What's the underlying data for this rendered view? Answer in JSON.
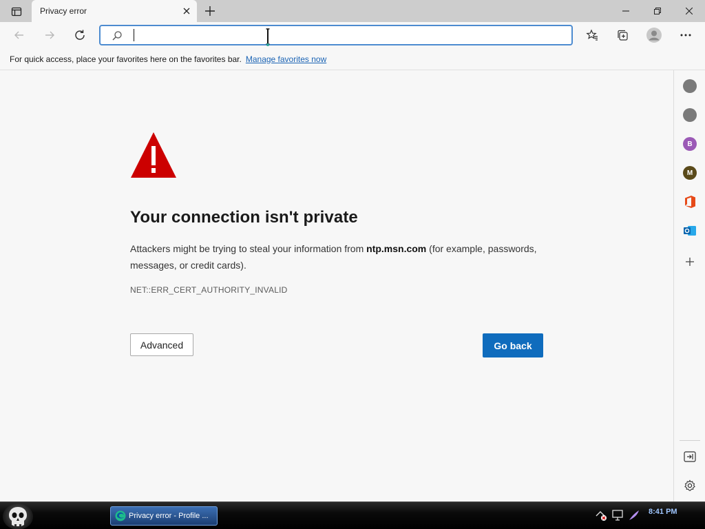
{
  "tab": {
    "title": "Privacy error"
  },
  "addressbar": {
    "value": "",
    "placeholder": ""
  },
  "favorites_bar": {
    "text": "For quick access, place your favorites here on the favorites bar.",
    "link": "Manage favorites now"
  },
  "error_page": {
    "heading": "Your connection isn't private",
    "desc_before": "Attackers might be trying to steal your information from ",
    "desc_host": "ntp.msn.com",
    "desc_after": " (for example, passwords, messages, or credit cards).",
    "error_code": "NET::ERR_CERT_AUTHORITY_INVALID",
    "advanced_label": "Advanced",
    "go_back_label": "Go back"
  },
  "sidebar": {
    "items": [
      {
        "name": "sidebar-item-1",
        "type": "dot",
        "color": "#7a7a7a"
      },
      {
        "name": "sidebar-item-2",
        "type": "dot",
        "color": "#7a7a7a"
      },
      {
        "name": "sidebar-item-b",
        "type": "letter",
        "letter": "B",
        "color": "#9b59b6"
      },
      {
        "name": "sidebar-item-m",
        "type": "letter",
        "letter": "M",
        "color": "#5a4a1a"
      },
      {
        "name": "sidebar-item-office",
        "type": "office-icon"
      },
      {
        "name": "sidebar-item-outlook",
        "type": "outlook-icon"
      }
    ]
  },
  "taskbar": {
    "app_label": "Privacy error - Profile ...",
    "clock": "8:41 PM"
  },
  "colors": {
    "accent": "#0f6cbd",
    "warning_red": "#cc0000",
    "link": "#1a63b4"
  }
}
